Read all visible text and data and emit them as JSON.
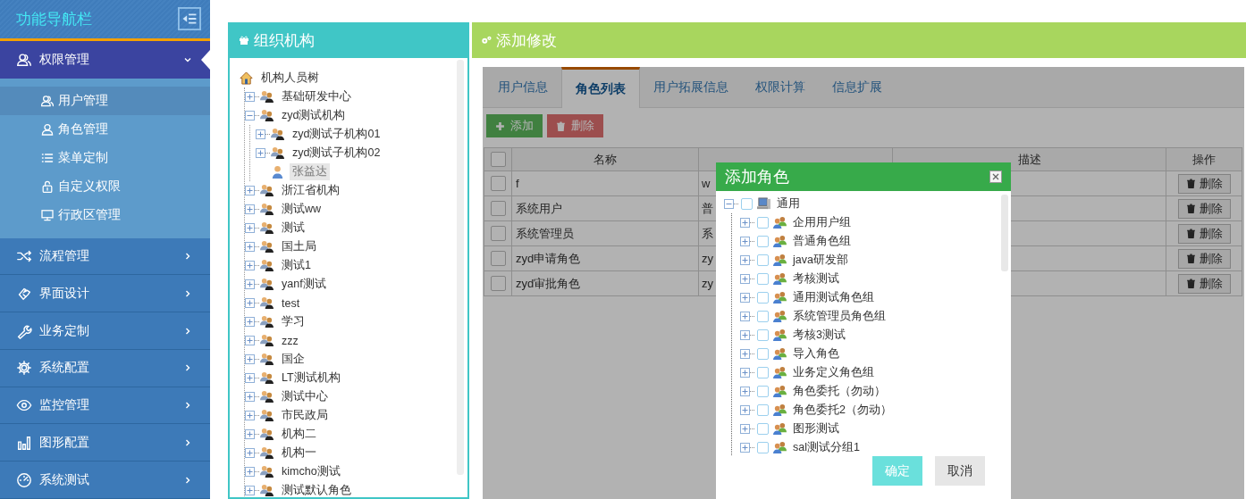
{
  "sidebar": {
    "title": "功能导航栏",
    "menus": [
      {
        "label": "权限管理",
        "expanded": true,
        "children": [
          {
            "label": "用户管理",
            "selected": true
          },
          {
            "label": "角色管理",
            "selected": false
          },
          {
            "label": "菜单定制",
            "selected": false
          },
          {
            "label": "自定义权限",
            "selected": false
          },
          {
            "label": "行政区管理",
            "selected": false
          }
        ]
      },
      {
        "label": "流程管理",
        "expanded": false
      },
      {
        "label": "界面设计",
        "expanded": false
      },
      {
        "label": "业务定制",
        "expanded": false
      },
      {
        "label": "系统配置",
        "expanded": false
      },
      {
        "label": "监控管理",
        "expanded": false
      },
      {
        "label": "图形配置",
        "expanded": false
      },
      {
        "label": "系统测试",
        "expanded": false
      }
    ]
  },
  "org_panel": {
    "title": "组织机构",
    "tree": {
      "label": "机构人员树",
      "children": [
        {
          "label": "基础研发中心",
          "kind": "org",
          "expanded": false,
          "selected": false
        },
        {
          "label": "zyd测试机构",
          "kind": "org",
          "expanded": true,
          "selected": false,
          "children": [
            {
              "label": "zyd测试子机构01",
              "kind": "org",
              "expanded": false,
              "selected": false
            },
            {
              "label": "zyd测试子机构02",
              "kind": "org",
              "expanded": false,
              "selected": false
            },
            {
              "label": "张益达",
              "kind": "person",
              "selected": true
            }
          ]
        },
        {
          "label": "浙江省机构",
          "kind": "org",
          "expanded": false,
          "selected": false
        },
        {
          "label": "测试ww",
          "kind": "org",
          "expanded": false,
          "selected": false
        },
        {
          "label": "测试",
          "kind": "org",
          "expanded": false,
          "selected": false
        },
        {
          "label": "国土局",
          "kind": "org",
          "expanded": false,
          "selected": false
        },
        {
          "label": "测试1",
          "kind": "org",
          "expanded": false,
          "selected": false
        },
        {
          "label": "yanf测试",
          "kind": "org",
          "expanded": false,
          "selected": false
        },
        {
          "label": "test",
          "kind": "org",
          "expanded": false,
          "selected": false
        },
        {
          "label": "学习",
          "kind": "org",
          "expanded": false,
          "selected": false
        },
        {
          "label": "zzz",
          "kind": "org",
          "expanded": false,
          "selected": false
        },
        {
          "label": "国企",
          "kind": "org",
          "expanded": false,
          "selected": false
        },
        {
          "label": "LT测试机构",
          "kind": "org",
          "expanded": false,
          "selected": false
        },
        {
          "label": "测试中心",
          "kind": "org",
          "expanded": false,
          "selected": false
        },
        {
          "label": "市民政局",
          "kind": "org",
          "expanded": false,
          "selected": false
        },
        {
          "label": "机构二",
          "kind": "org",
          "expanded": false,
          "selected": false
        },
        {
          "label": "机构一",
          "kind": "org",
          "expanded": false,
          "selected": false
        },
        {
          "label": "kimcho测试",
          "kind": "org",
          "expanded": false,
          "selected": false
        },
        {
          "label": "测试默认角色",
          "kind": "org",
          "expanded": false,
          "selected": false
        }
      ]
    }
  },
  "edit_panel": {
    "title": "添加修改",
    "tabs": [
      {
        "label": "用户信息",
        "selected": false
      },
      {
        "label": "角色列表",
        "selected": true
      },
      {
        "label": "用户拓展信息",
        "selected": false
      },
      {
        "label": "权限计算",
        "selected": false
      },
      {
        "label": "信息扩展",
        "selected": false
      }
    ],
    "toolbar": {
      "add": "添加",
      "delete": "删除"
    },
    "table": {
      "header_checked": false,
      "columns": [
        {
          "kind": "name",
          "label": "名称"
        },
        {
          "kind": "group"
        },
        {
          "kind": "description",
          "label": "描述"
        },
        {
          "kind": "action",
          "label": "操作"
        }
      ],
      "rows": [
        {
          "checked": false,
          "name": "f",
          "group": "w",
          "action": "删除"
        },
        {
          "checked": false,
          "name": "系统用户",
          "group": "普",
          "action": "删除"
        },
        {
          "checked": false,
          "name": "系统管理员",
          "group": "系",
          "action": "删除"
        },
        {
          "checked": false,
          "name": "zyd申请角色",
          "group": "zy",
          "action": "删除"
        },
        {
          "checked": false,
          "name": "zyd审批角色",
          "group": "zy",
          "action": "删除"
        }
      ]
    }
  },
  "dialog": {
    "title": "添加角色",
    "tree": {
      "label": "通用",
      "checked": false,
      "expanded": true,
      "children": [
        {
          "label": "企用用户组",
          "checked": false,
          "expanded": false
        },
        {
          "label": "普通角色组",
          "checked": false,
          "expanded": false
        },
        {
          "label": "java研发部",
          "checked": false,
          "expanded": false
        },
        {
          "label": "考核测试",
          "checked": false,
          "expanded": false
        },
        {
          "label": "通用测试角色组",
          "checked": false,
          "expanded": false
        },
        {
          "label": "系统管理员角色组",
          "checked": false,
          "expanded": false
        },
        {
          "label": "考核3测试",
          "checked": false,
          "expanded": false
        },
        {
          "label": "导入角色",
          "checked": false,
          "expanded": false
        },
        {
          "label": "业务定义角色组",
          "checked": false,
          "expanded": false
        },
        {
          "label": "角色委托（勿动）",
          "checked": false,
          "expanded": false
        },
        {
          "label": "角色委托2（勿动）",
          "checked": false,
          "expanded": false
        },
        {
          "label": "图形测试",
          "checked": false,
          "expanded": false
        },
        {
          "label": "sal测试分组1",
          "checked": false,
          "expanded": false
        }
      ]
    },
    "confirm": "确定",
    "cancel": "取消"
  }
}
